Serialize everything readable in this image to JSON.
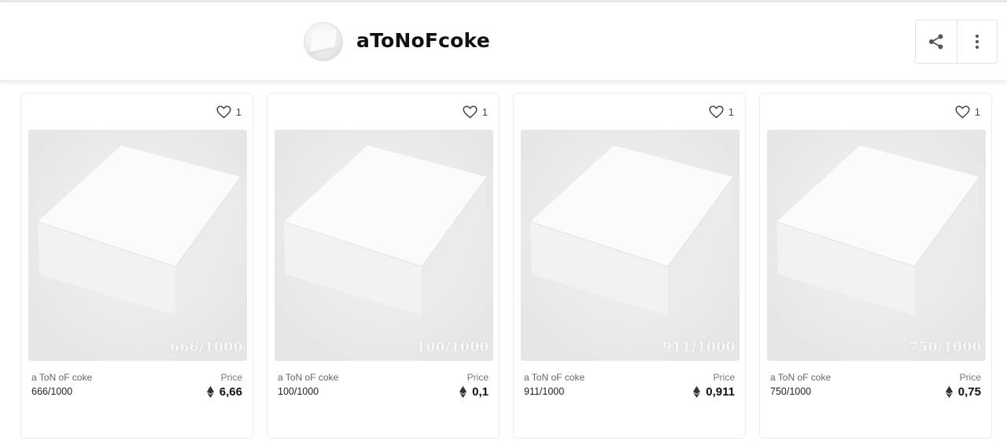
{
  "header": {
    "collection_title": "aToNoFcoke",
    "share_icon": "share-icon",
    "more_icon": "more-vertical-icon"
  },
  "cards": [
    {
      "likes": "1",
      "watermark": "666/1000",
      "collection": "a ToN oF coke",
      "name": "666/1000",
      "price_label": "Price",
      "price": "6,66"
    },
    {
      "likes": "1",
      "watermark": "100/1000",
      "collection": "a ToN oF coke",
      "name": "100/1000",
      "price_label": "Price",
      "price": "0,1"
    },
    {
      "likes": "1",
      "watermark": "911/1000",
      "collection": "a ToN oF coke",
      "name": "911/1000",
      "price_label": "Price",
      "price": "0,911"
    },
    {
      "likes": "1",
      "watermark": "750/1000",
      "collection": "a ToN oF coke",
      "name": "750/1000",
      "price_label": "Price",
      "price": "0,75"
    }
  ],
  "icons": {
    "like": "heart-icon",
    "currency": "eth-icon"
  },
  "colors": {
    "header_bg": "#ffffff",
    "thumb_bg": "#e8e8e9",
    "card_border": "#ececef"
  }
}
